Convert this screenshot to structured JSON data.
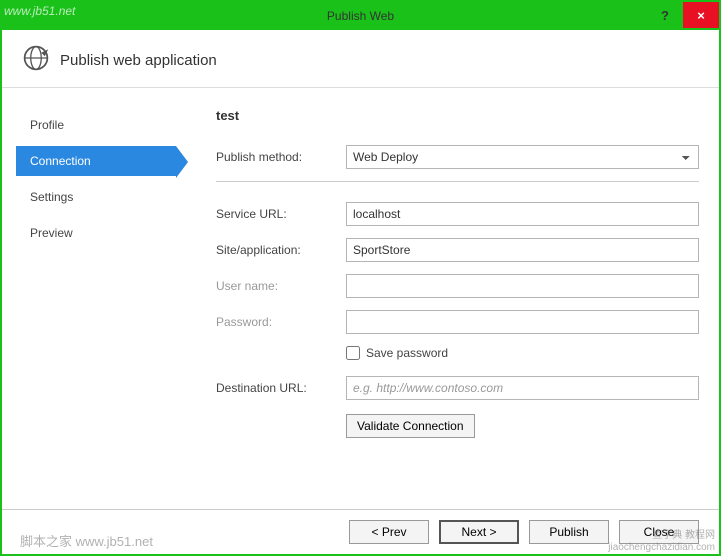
{
  "window": {
    "title": "Publish Web",
    "help": "?",
    "close": "×"
  },
  "header": {
    "title": "Publish web application"
  },
  "sidebar": {
    "items": [
      {
        "label": "Profile",
        "active": false
      },
      {
        "label": "Connection",
        "active": true
      },
      {
        "label": "Settings",
        "active": false
      },
      {
        "label": "Preview",
        "active": false
      }
    ]
  },
  "form": {
    "profile_name": "test",
    "publish_method_label": "Publish method:",
    "publish_method_value": "Web Deploy",
    "service_url_label": "Service URL:",
    "service_url_value": "localhost",
    "site_app_label": "Site/application:",
    "site_app_value": "SportStore",
    "username_label": "User name:",
    "username_value": "",
    "password_label": "Password:",
    "password_value": "",
    "save_password_label": "Save password",
    "dest_url_label": "Destination URL:",
    "dest_url_placeholder": "e.g. http://www.contoso.com",
    "dest_url_value": "",
    "validate_label": "Validate Connection"
  },
  "footer": {
    "prev": "< Prev",
    "next": "Next >",
    "publish": "Publish",
    "close": "Close"
  },
  "watermarks": {
    "tl": "www.jb51.net",
    "bl": "脚本之家  www.jb51.net",
    "br1": "查字典 教程网",
    "br2": "jiaochengchazidian.com"
  }
}
